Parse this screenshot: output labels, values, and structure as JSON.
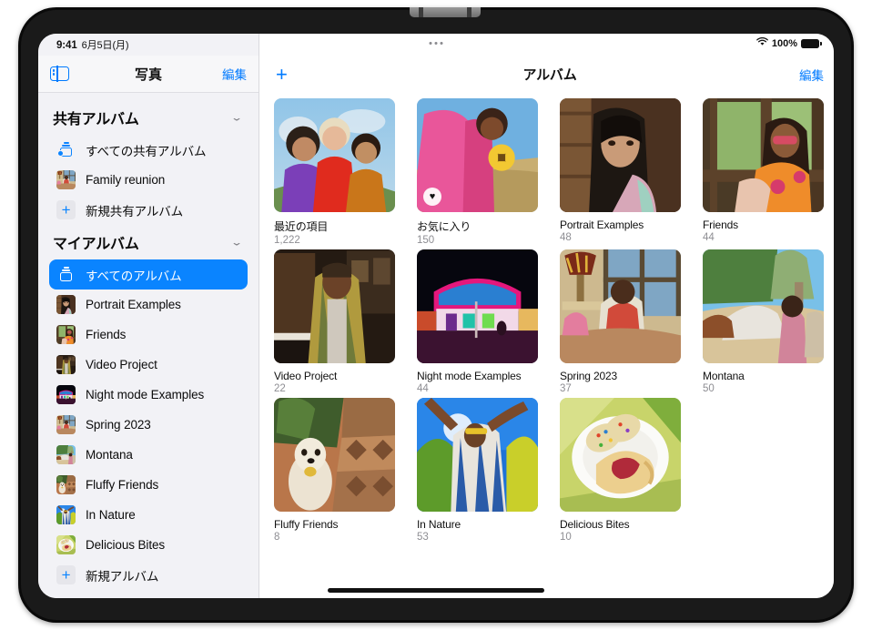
{
  "status_bar": {
    "time": "9:41",
    "date": "6月5日(月)",
    "battery_percent": "100%",
    "wifi_icon": "wifi-icon",
    "battery_icon": "battery-icon",
    "menu_dots_icon": "multitasking-dots-icon"
  },
  "sidebar": {
    "toggle_icon": "sidebar-toggle-icon",
    "title": "写真",
    "edit_label": "編集",
    "sections": [
      {
        "header": "共有アルバム",
        "chevron_icon": "chevron-down-icon",
        "items": [
          {
            "label": "すべての共有アルバム",
            "icon": "shared-album-icon",
            "selected": false
          },
          {
            "label": "Family reunion",
            "icon": "album-thumbnail",
            "selected": false
          },
          {
            "label": "新規共有アルバム",
            "icon": "plus-icon",
            "selected": false
          }
        ]
      },
      {
        "header": "マイアルバム",
        "chevron_icon": "chevron-down-icon",
        "items": [
          {
            "label": "すべてのアルバム",
            "icon": "album-stack-icon",
            "selected": true
          },
          {
            "label": "Portrait Examples",
            "icon": "album-thumbnail",
            "selected": false
          },
          {
            "label": "Friends",
            "icon": "album-thumbnail",
            "selected": false
          },
          {
            "label": "Video Project",
            "icon": "album-thumbnail",
            "selected": false
          },
          {
            "label": "Night mode Examples",
            "icon": "album-thumbnail",
            "selected": false
          },
          {
            "label": "Spring 2023",
            "icon": "album-thumbnail",
            "selected": false
          },
          {
            "label": "Montana",
            "icon": "album-thumbnail",
            "selected": false
          },
          {
            "label": "Fluffy Friends",
            "icon": "album-thumbnail",
            "selected": false
          },
          {
            "label": "In Nature",
            "icon": "album-thumbnail",
            "selected": false
          },
          {
            "label": "Delicious Bites",
            "icon": "album-thumbnail",
            "selected": false
          },
          {
            "label": "新規アルバム",
            "icon": "plus-icon",
            "selected": false
          }
        ]
      }
    ]
  },
  "main": {
    "add_button_label": "+",
    "add_button_icon": "plus-icon",
    "title": "アルバム",
    "edit_label": "編集",
    "albums": [
      {
        "name": "最近の項目",
        "count": "1,222",
        "favorite_badge": false
      },
      {
        "name": "お気に入り",
        "count": "150",
        "favorite_badge": true,
        "badge_icon": "heart-icon"
      },
      {
        "name": "Portrait Examples",
        "count": "48",
        "favorite_badge": false
      },
      {
        "name": "Friends",
        "count": "44",
        "favorite_badge": false
      },
      {
        "name": "Video Project",
        "count": "22",
        "favorite_badge": false
      },
      {
        "name": "Night mode Examples",
        "count": "44",
        "favorite_badge": false
      },
      {
        "name": "Spring 2023",
        "count": "37",
        "favorite_badge": false
      },
      {
        "name": "Montana",
        "count": "50",
        "favorite_badge": false
      },
      {
        "name": "Fluffy Friends",
        "count": "8",
        "favorite_badge": false
      },
      {
        "name": "In Nature",
        "count": "53",
        "favorite_badge": false
      },
      {
        "name": "Delicious Bites",
        "count": "10",
        "favorite_badge": false
      }
    ]
  },
  "home_indicator": "home-indicator",
  "colors": {
    "accent_blue": "#007aff",
    "selection_blue": "#0a84ff",
    "sidebar_bg": "#f2f2f6",
    "secondary_text": "#8e8e93"
  }
}
